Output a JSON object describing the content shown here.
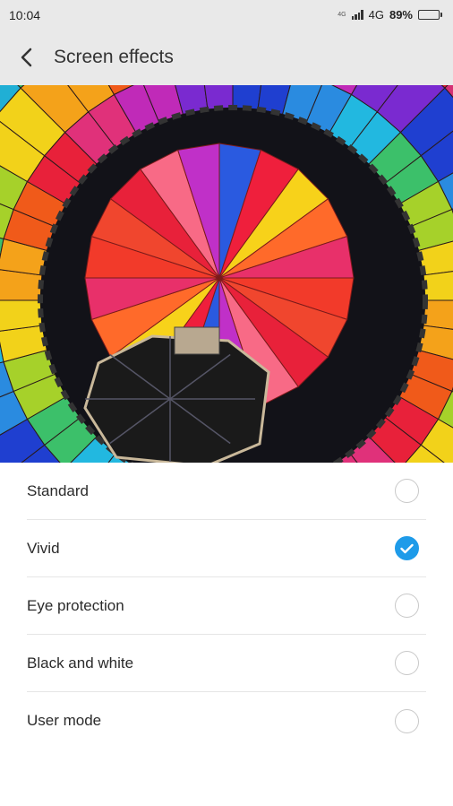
{
  "status": {
    "time": "10:04",
    "sim": "4G",
    "network": "4G",
    "battery": "89%",
    "battery_level": 0.89
  },
  "header": {
    "title": "Screen effects",
    "back_icon": "chevron-left-icon"
  },
  "hero": {
    "subject": "hot-air-balloon-photo"
  },
  "options": [
    {
      "label": "Standard",
      "selected": false
    },
    {
      "label": "Vivid",
      "selected": true
    },
    {
      "label": "Eye protection",
      "selected": false
    },
    {
      "label": "Black and white",
      "selected": false
    },
    {
      "label": "User mode",
      "selected": false
    }
  ],
  "colors": {
    "accent": "#1e9be9",
    "bar_bg": "#e9e9e9"
  }
}
